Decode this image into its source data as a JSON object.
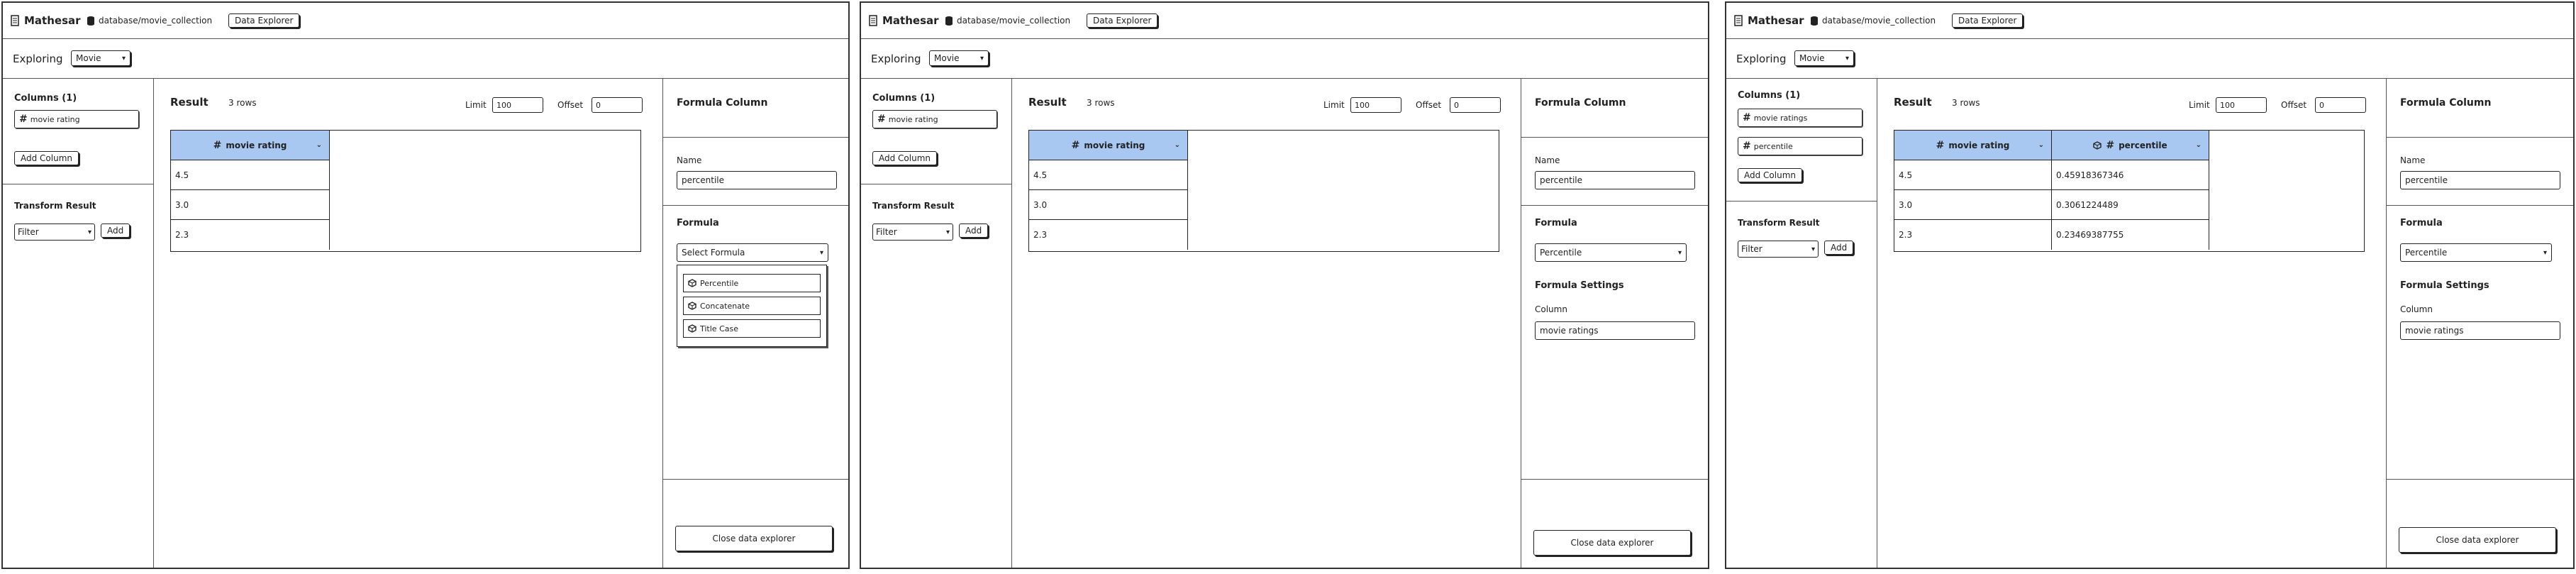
{
  "app": {
    "name": "Mathesar",
    "db_path": "database/movie_collection",
    "explorer_button": "Data Explorer"
  },
  "explore": {
    "label": "Exploring",
    "table": "Movie"
  },
  "left": {
    "columns_title_1": "Columns (1)",
    "columns_title_2": "Columns (1)",
    "columns_title_3": "Columns (1)",
    "add_column": "Add Column",
    "transform_title": "Transform Result",
    "filter": "Filter",
    "add": "Add"
  },
  "result": {
    "title": "Result",
    "rows": "3 rows",
    "limit_label": "Limit",
    "limit": "100",
    "offset_label": "Offset",
    "offset": "0"
  },
  "screen1": {
    "columns": [
      "movie rating"
    ],
    "grid_header": "movie rating",
    "values": [
      "4.5",
      "3.0",
      "2.3"
    ]
  },
  "screen2": {
    "columns": [
      "movie rating"
    ],
    "grid_header": "movie rating",
    "values": [
      "4.5",
      "3.0",
      "2.3"
    ]
  },
  "screen3": {
    "columns": [
      "movie ratings",
      "percentile"
    ],
    "grid_headers": [
      "movie rating",
      "percentile"
    ],
    "rows": [
      [
        "4.5",
        "0.45918367346"
      ],
      [
        "3.0",
        "0.3061224489"
      ],
      [
        "2.3",
        "0.23469387755"
      ]
    ]
  },
  "formula": {
    "panel_title": "Formula Column",
    "name_label": "Name",
    "name_value": "percentile",
    "formula_label": "Formula",
    "select_placeholder": "Select Formula",
    "options": [
      "Percentile",
      "Concatenate",
      "Title Case"
    ],
    "selected": "Percentile",
    "settings_title": "Formula Settings",
    "column_label": "Column",
    "column_value": "movie ratings",
    "close": "Close data explorer"
  },
  "colors": {
    "header_blue": "#a8c8f2",
    "line": "#222222"
  },
  "icons": [
    "mathesar-logo-icon",
    "database-icon",
    "hash-icon",
    "chevron-down-icon",
    "formula-cube-icon"
  ]
}
